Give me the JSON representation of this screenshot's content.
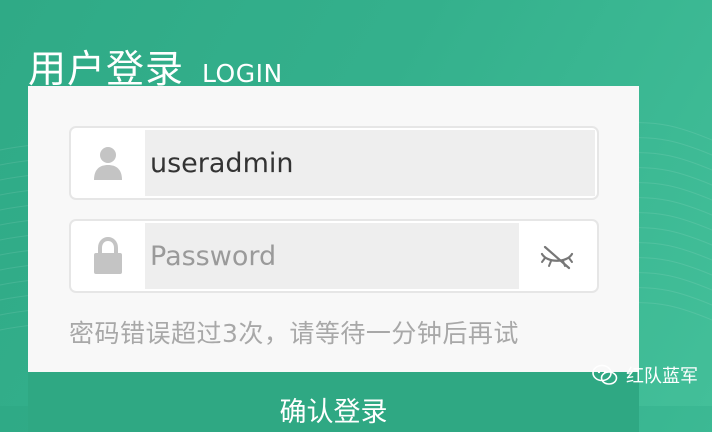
{
  "header": {
    "title_cn": "用户登录",
    "title_en": "LOGIN"
  },
  "form": {
    "username": {
      "value": "useradmin",
      "icon": "user-icon"
    },
    "password": {
      "value": "",
      "placeholder": "Password",
      "icon": "lock-icon",
      "toggle_icon": "eye-off-icon"
    },
    "error_message": "密码错误超过3次，请等待一分钟后再试",
    "submit_label": "确认登录"
  },
  "watermark": {
    "text": "红队蓝军",
    "icon": "wechat-icon"
  },
  "colors": {
    "accent": "#2fa883",
    "background": "#36b28d",
    "panel": "#f8f8f8",
    "input_bg": "#eeeeee",
    "error_text": "#a8a8a8"
  }
}
